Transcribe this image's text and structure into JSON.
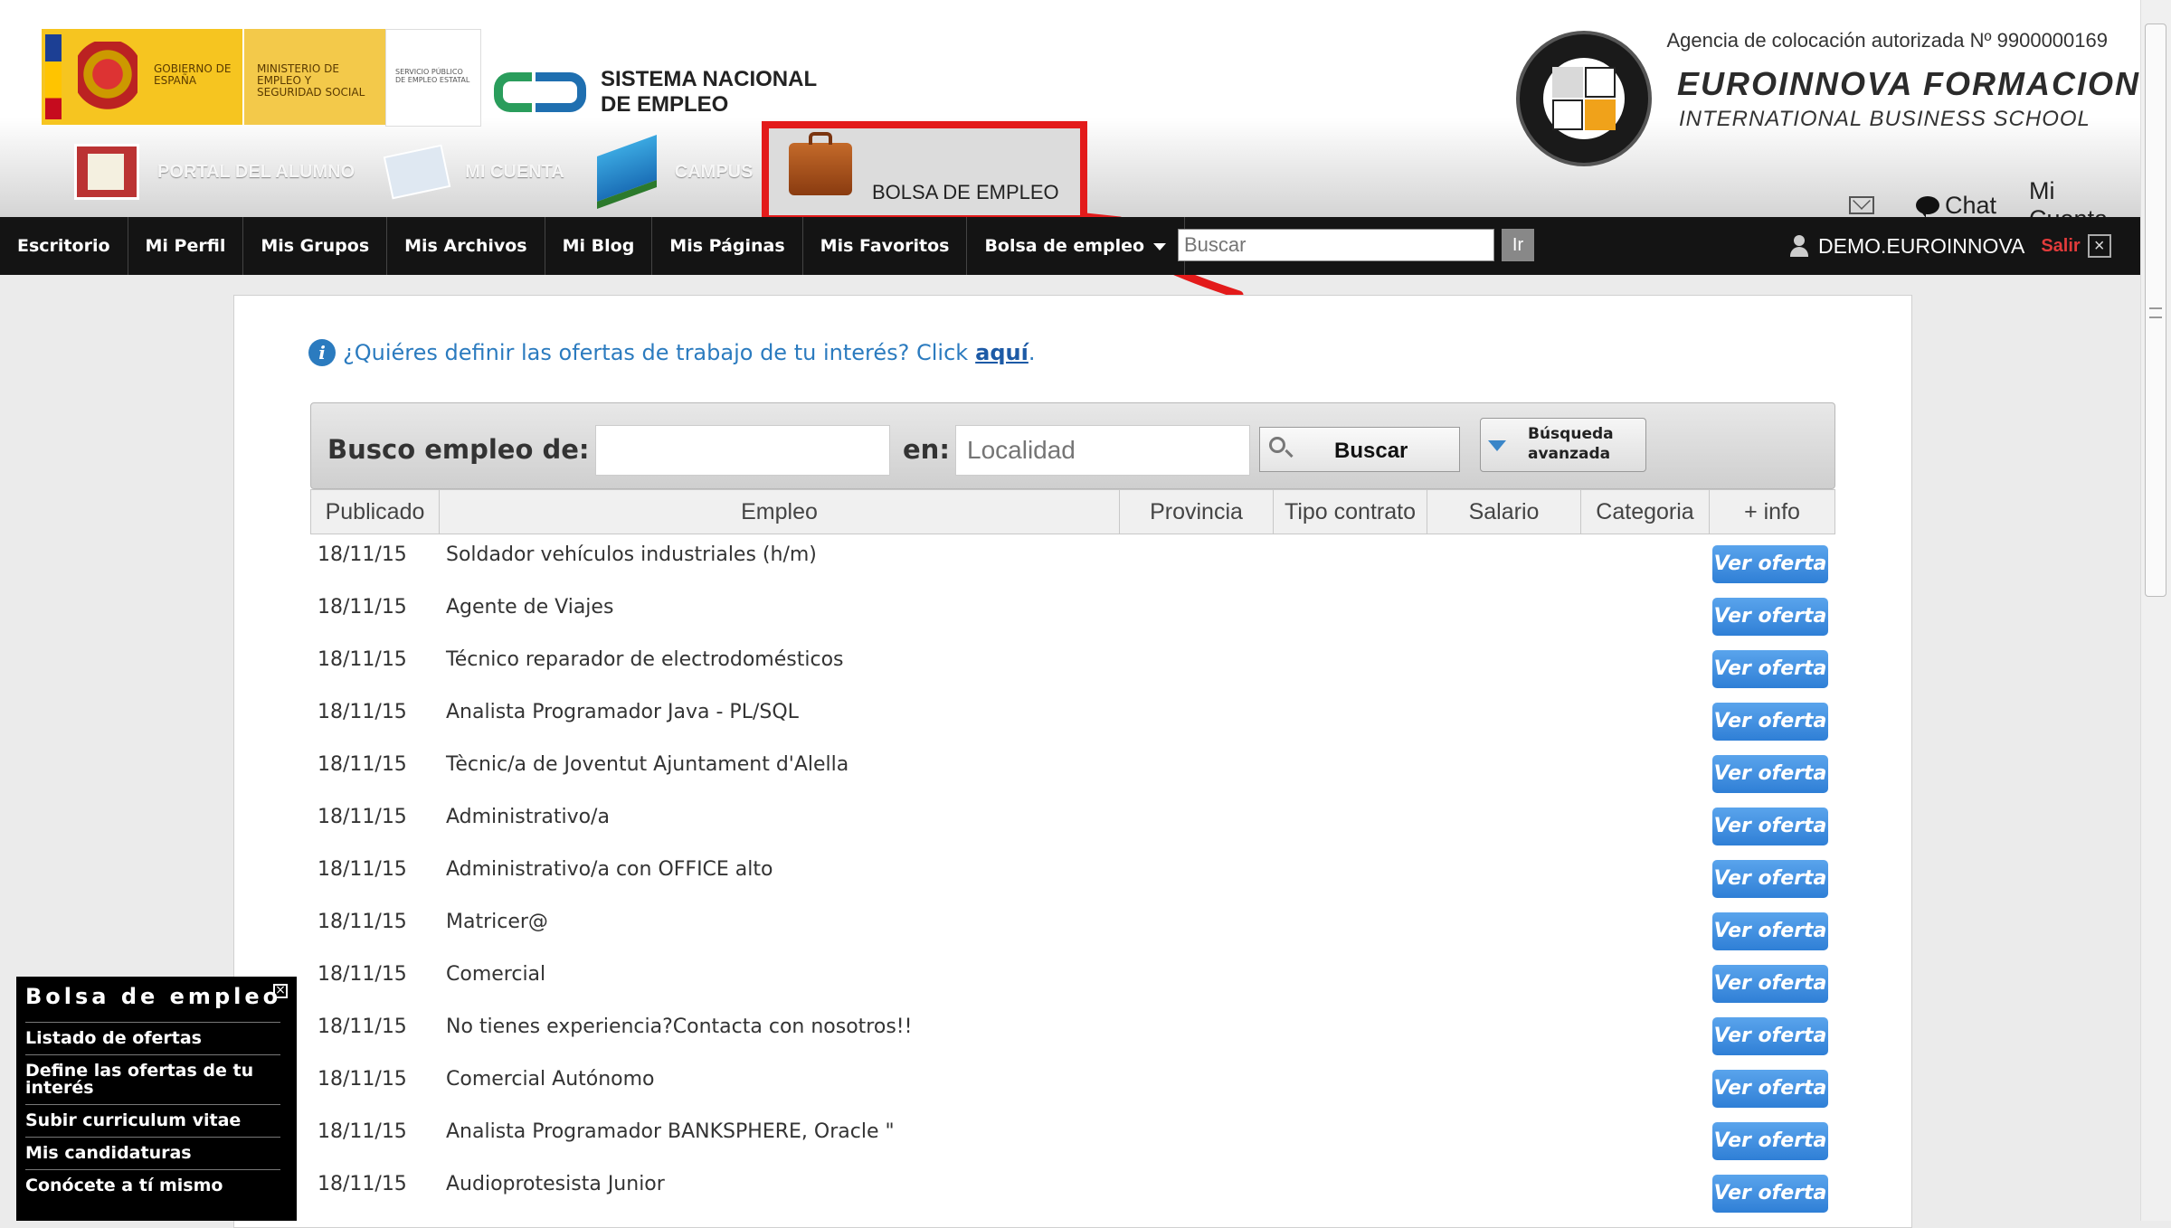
{
  "header": {
    "gov_spain": "GOBIERNO DE ESPAÑA",
    "ministry": "MINISTERIO DE EMPLEO Y SEGURIDAD SOCIAL",
    "sepe": "SERVICIO PÚBLICO DE EMPLEO ESTATAL",
    "sne": "SISTEMA NACIONAL DE EMPLEO",
    "agencia": "Agencia de colocación autorizada Nº 9900000169",
    "brand_name": "EUROINNOVA FORMACION",
    "brand_sub": "INTERNATIONAL BUSINESS SCHOOL",
    "top_nav": [
      {
        "label": "PORTAL DEL ALUMNO",
        "icon": "portal-icon"
      },
      {
        "label": "MI CUENTA",
        "icon": "id-card-icon"
      },
      {
        "label": "CAMPUS",
        "icon": "books-icon"
      }
    ],
    "bolsa_label": "BOLSA DE EMPLEO",
    "chat_label": "Chat",
    "mi_cuenta_label": "Mi Cuenta",
    "highlight_color": "#e31b1b"
  },
  "navbar": {
    "items": [
      "Escritorio",
      "Mi Perfil",
      "Mis Grupos",
      "Mis Archivos",
      "Mi Blog",
      "Mis Páginas",
      "Mis Favoritos",
      "Bolsa de empleo"
    ],
    "search_placeholder": "Buscar",
    "ir_label": "Ir",
    "username": "DEMO.EUROINNOVA",
    "salir_label": "Salir"
  },
  "main": {
    "info_text": "¿Quiéres definir las ofertas de trabajo de tu interés? Click",
    "info_link": "aquí",
    "info_tail": ".",
    "search": {
      "busco_label": "Busco empleo de:",
      "busco_value": "",
      "en_label": "en:",
      "localidad_placeholder": "Localidad",
      "buscar_label": "Buscar",
      "advanced_line1": "Búsqueda",
      "advanced_line2": "avanzada"
    },
    "columns": [
      "Publicado",
      "Empleo",
      "Provincia",
      "Tipo contrato",
      "Salario",
      "Categoria",
      "+ info"
    ],
    "button_label": "Ver oferta",
    "offers": [
      {
        "date": "18/11/15",
        "title": "Soldador vehículos industriales (h/m)"
      },
      {
        "date": "18/11/15",
        "title": "Agente de Viajes"
      },
      {
        "date": "18/11/15",
        "title": "Técnico reparador de electrodomésticos"
      },
      {
        "date": "18/11/15",
        "title": "Analista Programador Java - PL/SQL"
      },
      {
        "date": "18/11/15",
        "title": "Tècnic/a de Joventut Ajuntament d'Alella"
      },
      {
        "date": "18/11/15",
        "title": "Administrativo/a"
      },
      {
        "date": "18/11/15",
        "title": "Administrativo/a con OFFICE alto"
      },
      {
        "date": "18/11/15",
        "title": "Matricer@"
      },
      {
        "date": "18/11/15",
        "title": "Comercial"
      },
      {
        "date": "18/11/15",
        "title": "No tienes experiencia?Contacta con nosotros!!"
      },
      {
        "date": "18/11/15",
        "title": "Comercial Autónomo"
      },
      {
        "date": "18/11/15",
        "title": "Analista Programador BANKSPHERE, Oracle \""
      },
      {
        "date": "18/11/15",
        "title": "Audioprotesista Junior"
      }
    ]
  },
  "side_widget": {
    "title": "Bolsa de empleo",
    "items": [
      "Listado de ofertas",
      "Define las ofertas de tu interés",
      "Subir curriculum vitae",
      "Mis candidaturas",
      "Conócete a tí mismo"
    ]
  }
}
